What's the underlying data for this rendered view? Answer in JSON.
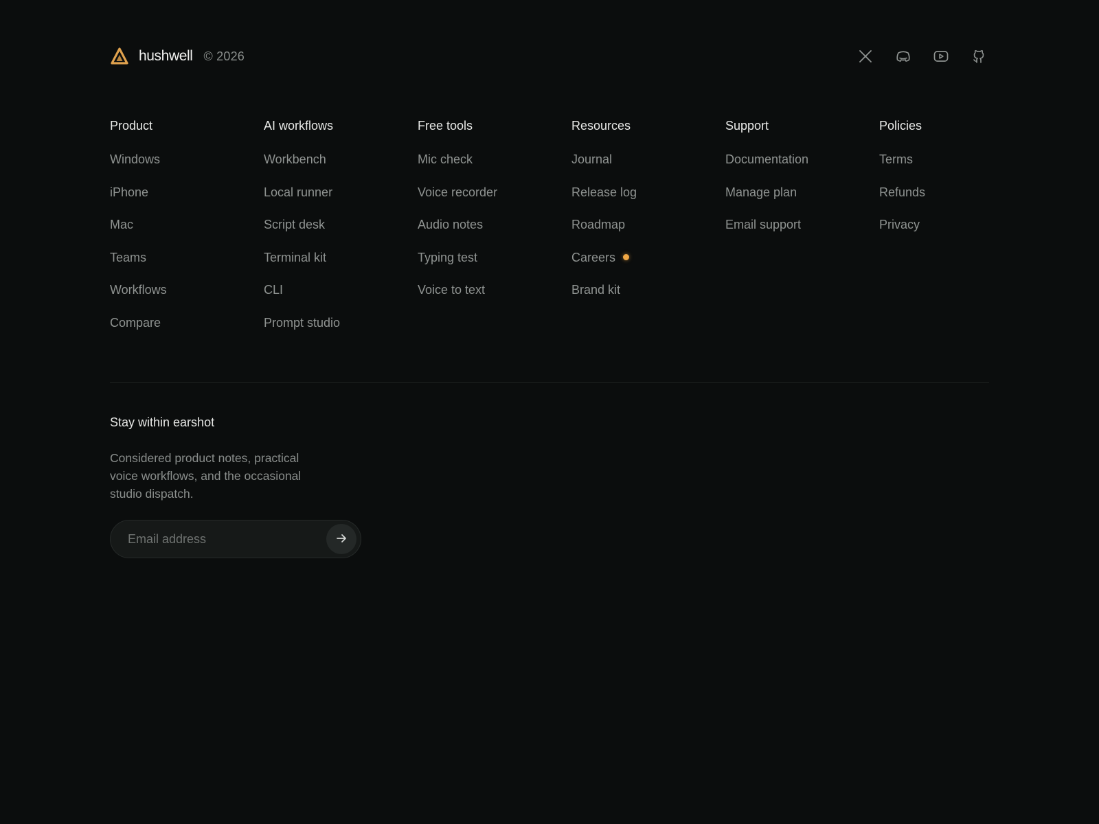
{
  "brand": {
    "name": "hushwell",
    "copyright": "© 2026",
    "logo_icon": "triangle-logo-icon",
    "accent_color": "#f0a745"
  },
  "socials": [
    {
      "icon": "x-icon",
      "label": "X"
    },
    {
      "icon": "discord-icon",
      "label": "Discord"
    },
    {
      "icon": "youtube-icon",
      "label": "YouTube"
    },
    {
      "icon": "github-icon",
      "label": "GitHub"
    }
  ],
  "columns": [
    {
      "title": "Product",
      "links": [
        "Windows",
        "iPhone",
        "Mac",
        "Teams",
        "Workflows",
        "Compare"
      ]
    },
    {
      "title": "AI workflows",
      "links": [
        "Workbench",
        "Local runner",
        "Script desk",
        "Terminal kit",
        "CLI",
        "Prompt studio"
      ]
    },
    {
      "title": "Free tools",
      "links": [
        "Mic check",
        "Voice recorder",
        "Audio notes",
        "Typing test",
        "Voice to text"
      ]
    },
    {
      "title": "Resources",
      "links": [
        "Journal",
        "Release log",
        "Roadmap",
        "Careers",
        "Brand kit"
      ],
      "highlight": "Careers"
    },
    {
      "title": "Support",
      "links": [
        "Documentation",
        "Manage plan",
        "Email support"
      ]
    },
    {
      "title": "Policies",
      "links": [
        "Terms",
        "Refunds",
        "Privacy"
      ]
    }
  ],
  "newsletter": {
    "title": "Stay within earshot",
    "description": "Considered product notes, practical voice workflows, and the occasional studio dispatch.",
    "email_placeholder": "Email address",
    "email_value": "",
    "submit_icon": "arrow-right-icon"
  }
}
